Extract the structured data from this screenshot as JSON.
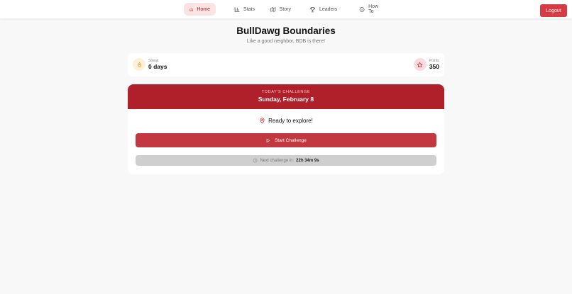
{
  "nav": {
    "items": [
      {
        "label": "Home",
        "icon": "home-icon",
        "active": true
      },
      {
        "label": "Stats",
        "icon": "bar-chart-icon",
        "active": false
      },
      {
        "label": "Story",
        "icon": "map-icon",
        "active": false
      },
      {
        "label": "Leaders",
        "icon": "trophy-icon",
        "active": false
      },
      {
        "label": "How To",
        "icon": "info-icon",
        "active": false
      }
    ],
    "logout_label": "Logout"
  },
  "header": {
    "title": "BullDawg Boundaries",
    "subtitle": "Like a good neighbor, BDB is there!"
  },
  "stats": {
    "streak": {
      "label": "Streak",
      "value": "0 days",
      "icon": "flame-icon"
    },
    "points": {
      "label": "Points",
      "value": "350",
      "icon": "star-icon"
    }
  },
  "challenge": {
    "kicker": "TODAY'S CHALLENGE",
    "date": "Sunday, February 8",
    "status": "Ready to explore!",
    "start_label": "Start Challenge",
    "next_label": "Next challenge in:",
    "next_time": "22h 34m 9s"
  },
  "colors": {
    "brand": "#b0202b",
    "button": "#c33840",
    "logout": "#d63a42"
  }
}
